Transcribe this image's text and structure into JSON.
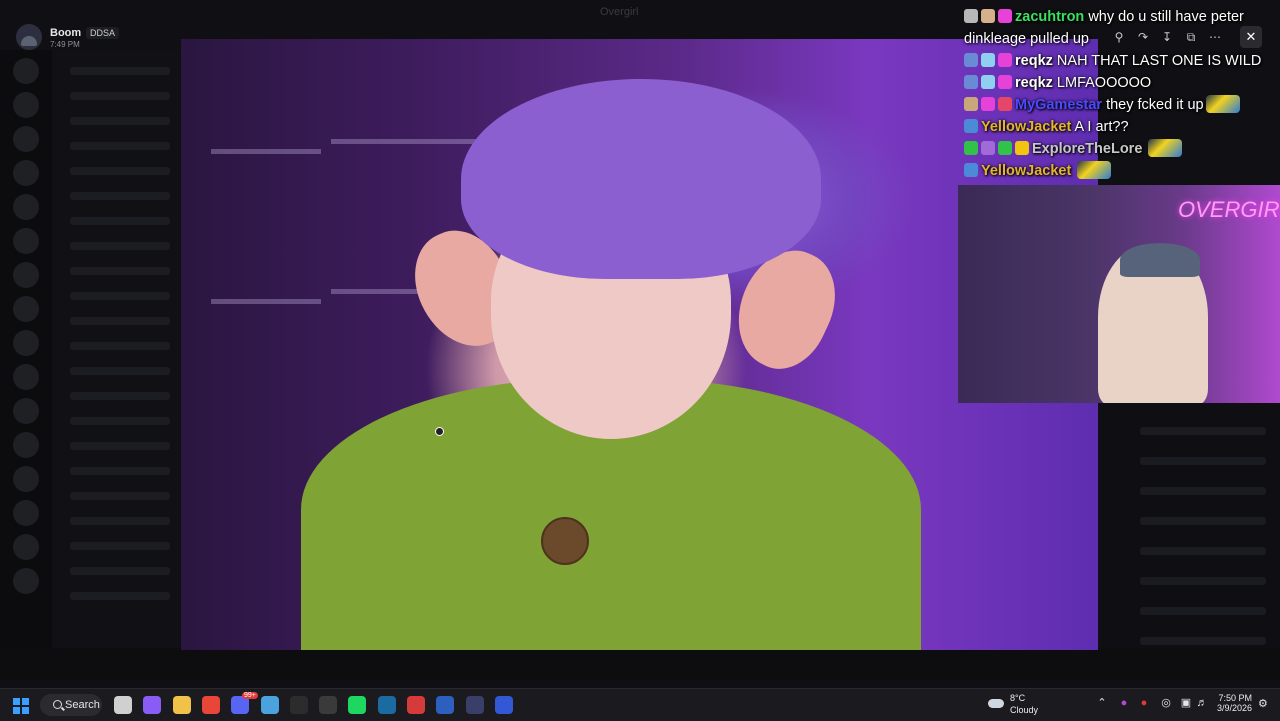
{
  "window": {
    "title": "Overgirl"
  },
  "notification": {
    "name": "Boom",
    "tag": "DDSA",
    "time": "7:49 PM"
  },
  "chat": [
    {
      "badges": [
        "#b7b7b7",
        "#d6b08a",
        "#e642d8"
      ],
      "user": "zacuhtron",
      "user_color": "#39e05f",
      "message": "why do u still have peter dinkleage pulled up",
      "emote": false
    },
    {
      "badges": [
        "#6b8ad6",
        "#8fd0f0",
        "#e642d8"
      ],
      "user": "reqkz",
      "user_color": "#ffffff",
      "message": "NAH THAT LAST ONE IS WILD",
      "emote": false
    },
    {
      "badges": [
        "#6b8ad6",
        "#8fd0f0",
        "#e642d8"
      ],
      "user": "reqkz",
      "user_color": "#ffffff",
      "message": "LMFAOOOOO",
      "emote": false
    },
    {
      "badges": [
        "#c9a77a",
        "#e642d8",
        "#e6466a"
      ],
      "user": "MyGamestar",
      "user_color": "#4a4bff",
      "message": "they fcked it up",
      "emote": true
    },
    {
      "badges": [
        "#4a8ad6"
      ],
      "user": "YellowJacket",
      "user_color": "#e4b52a",
      "message": "A I art??",
      "emote": false
    },
    {
      "badges": [
        "#31c24a",
        "#a06bd8",
        "#31c24a",
        "#f1c40f"
      ],
      "user": "ExploreTheLore",
      "user_color": "#c7c7c7",
      "message": "",
      "emote": true
    },
    {
      "badges": [
        "#4a8ad6"
      ],
      "user": "YellowJacket",
      "user_color": "#e4b52a",
      "message": "",
      "emote": true
    }
  ],
  "webcam": {
    "sign_text": "OVERGIRL"
  },
  "pip_controls": {
    "zoom": "zoom-icon",
    "share": "share-icon",
    "download": "download-icon",
    "popout": "popout-icon",
    "more": "more-icon",
    "close": "close-icon"
  },
  "taskbar": {
    "search_label": "Search",
    "apps": [
      {
        "name": "task-view",
        "color": "#d0d0d0"
      },
      {
        "name": "copilot",
        "color": "#8a5cf6"
      },
      {
        "name": "file-explorer",
        "color": "#f0c24a"
      },
      {
        "name": "chrome",
        "color": "#e9463a"
      },
      {
        "name": "discord",
        "color": "#5865f2"
      },
      {
        "name": "notepad",
        "color": "#4aa3df"
      },
      {
        "name": "epic-games",
        "color": "#2c2c2c"
      },
      {
        "name": "app-g",
        "color": "#3a3a3a"
      },
      {
        "name": "spotify",
        "color": "#1ed760"
      },
      {
        "name": "steam",
        "color": "#1b6aa0"
      },
      {
        "name": "game-app",
        "color": "#d73a3a"
      },
      {
        "name": "app-mcf",
        "color": "#2d5fbf"
      },
      {
        "name": "app-circle",
        "color": "#3a3f6a"
      },
      {
        "name": "media-player",
        "color": "#3358d6"
      }
    ],
    "discord_badge": "99+",
    "weather": {
      "temp": "8°C",
      "condition": "Cloudy"
    },
    "clock": {
      "time": "7:50 PM",
      "date": "3/9/2026"
    }
  }
}
